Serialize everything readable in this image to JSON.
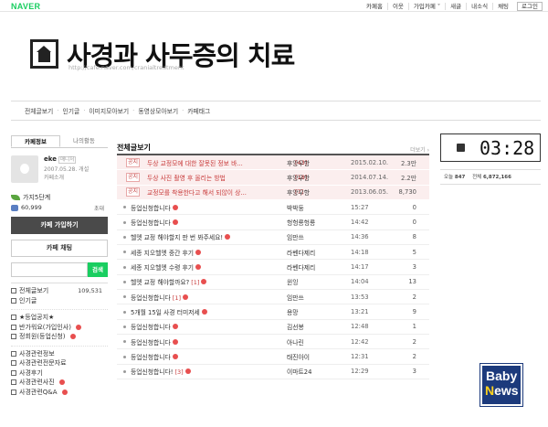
{
  "top": {
    "brand": "NAVER",
    "nav": [
      "카페홈",
      "이웃",
      "가입카페 ˅",
      "새글",
      "내소식",
      "채팅"
    ],
    "login": "로그인"
  },
  "cafe": {
    "title": "사경과 사두증의 치료",
    "url": "http://cafe.naver.com/cranialtreatment"
  },
  "menu": [
    "전체글보기",
    "인기글",
    "이미지모아보기",
    "동영상모아보기",
    "카페태그"
  ],
  "sidebar": {
    "tabs": [
      "카페정보",
      "나의활동"
    ],
    "profile": {
      "name": "eke",
      "role": "매니저",
      "since": "2007.05.28. 개설",
      "intro": "카페소개"
    },
    "level": "가지5단계",
    "members": "60,999",
    "invite": "초대",
    "join_label": "카페 가입하기",
    "chat_label": "카페 채팅",
    "search_placeholder": "",
    "search_btn": "검색",
    "all_posts": {
      "label": "전체글보기",
      "count": "109,531"
    },
    "popular": "인기글",
    "group1": [
      "★등업공지★",
      "반가워요(가입인사)",
      "정회원(등업신청)"
    ],
    "group2": [
      "사경관련정보",
      "사경관련전문자료",
      "사경후기",
      "사경관련사진",
      "사경관련Q&A"
    ]
  },
  "main": {
    "title": "전체글보기",
    "more": "더보기 ›",
    "notice_tag": "공지",
    "notices": [
      {
        "title": "두상 교정모에 대한 잘못된 정보 바...",
        "comments": "[43]",
        "author": "후앙우항",
        "date": "2015.02.10.",
        "views": "2.3만"
      },
      {
        "title": "두상 사진 촬영 후 올리는 방법",
        "comments": "[18]",
        "author": "후앙우항",
        "date": "2014.07.14.",
        "views": "2.2만"
      },
      {
        "title": "교정모를 착용한다고 해서 되않이 상...",
        "comments": "[7]",
        "author": "후앙우항",
        "date": "2013.06.05.",
        "views": "8,730"
      }
    ],
    "posts": [
      {
        "title": "등업신청합니다",
        "comments": "",
        "author": "박박둥",
        "date": "15:27",
        "views": "0"
      },
      {
        "title": "등업신청합니다",
        "comments": "",
        "author": "헝헝룡헝룡",
        "date": "14:42",
        "views": "0"
      },
      {
        "title": "헬멧 교정 해야할지 판 번 봐주세요!",
        "comments": "",
        "author": "임만쓰",
        "date": "14:36",
        "views": "8"
      },
      {
        "title": "세종 지오헬멧 중간 후기",
        "comments": "",
        "author": "라벤다제리",
        "date": "14:18",
        "views": "5"
      },
      {
        "title": "세종 지오헬멧 수령 후기",
        "comments": "",
        "author": "라벤다제리",
        "date": "14:17",
        "views": "3"
      },
      {
        "title": "헬멧 교정 해야할까요?",
        "comments": "[1]",
        "author": "윈잉",
        "date": "14:04",
        "views": "13"
      },
      {
        "title": "등업신청합니다",
        "comments": "[1]",
        "author": "임만쓰",
        "date": "13:53",
        "views": "2"
      },
      {
        "title": "5개월 15일 사경 터미저세",
        "comments": "",
        "author": "용망",
        "date": "13:21",
        "views": "9"
      },
      {
        "title": "등업신청합니다",
        "comments": "",
        "author": "김선봉",
        "date": "12:48",
        "views": "1"
      },
      {
        "title": "등업신청합니다",
        "comments": "",
        "author": "아나린",
        "date": "12:42",
        "views": "2"
      },
      {
        "title": "등업신청합니다",
        "comments": "",
        "author": "태진아이",
        "date": "12:31",
        "views": "2"
      },
      {
        "title": "등업신청합니다!",
        "comments": "[3]",
        "author": "이마트24",
        "date": "12:29",
        "views": "3"
      }
    ]
  },
  "right": {
    "clock": "03:28",
    "today_label": "오늘",
    "today": "847",
    "total_label": "전체",
    "total": "6,872,166"
  },
  "badge": {
    "line1": "Baby",
    "line2a": "N",
    "line2b": "ews"
  }
}
